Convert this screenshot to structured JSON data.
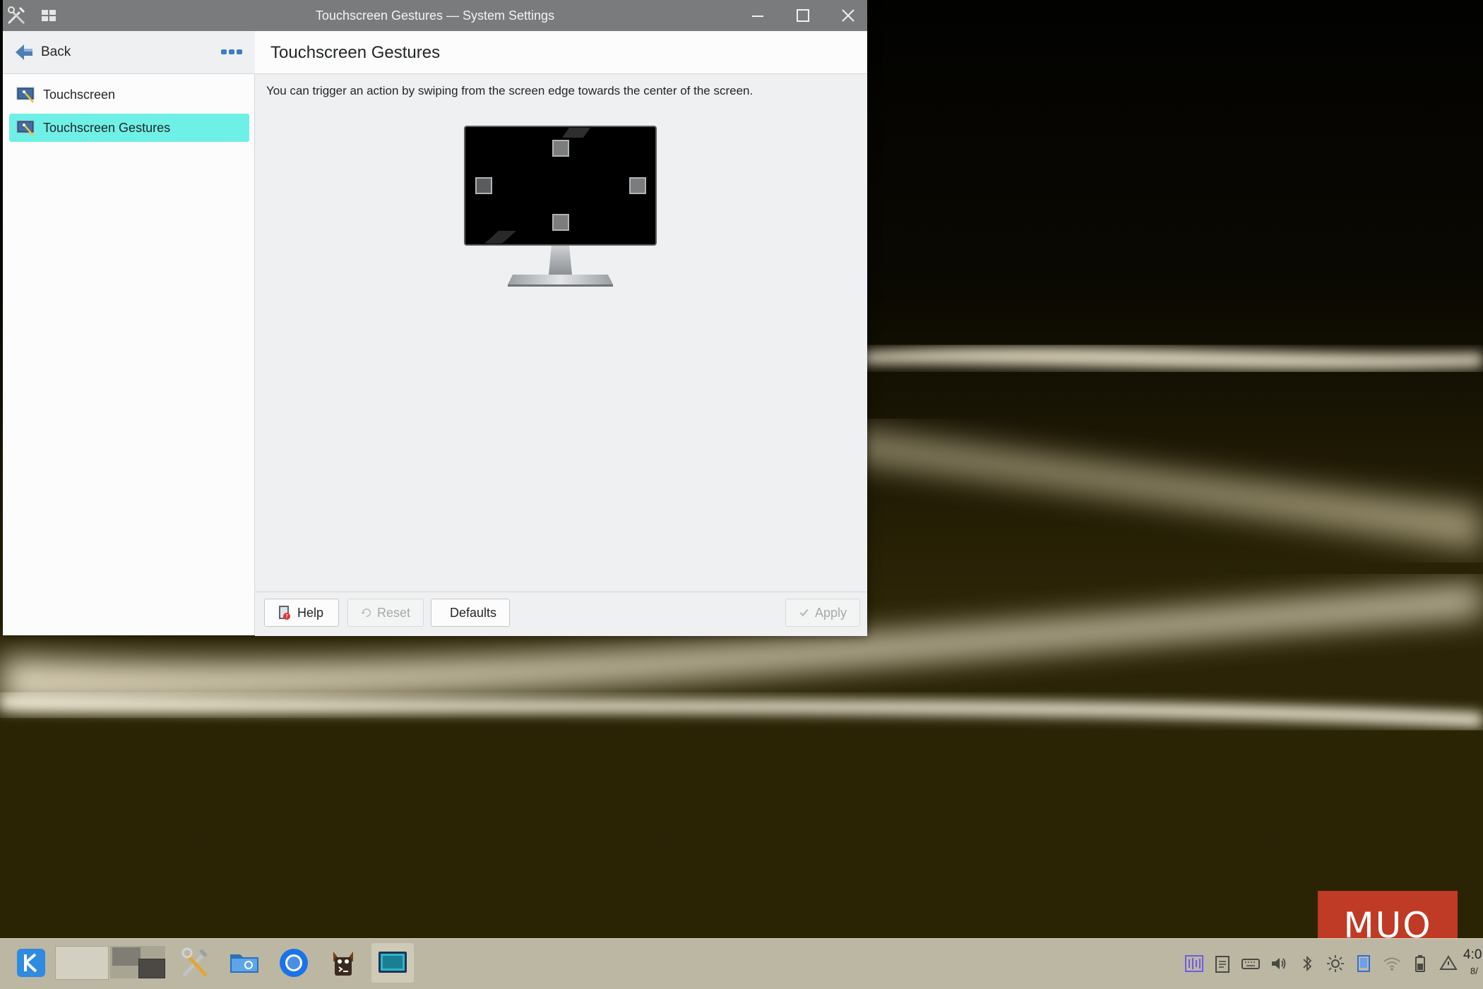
{
  "window": {
    "title": "Touchscreen Gestures — System Settings"
  },
  "sidebar": {
    "back_label": "Back",
    "items": [
      {
        "label": "Touchscreen",
        "icon": "touchscreen-icon"
      },
      {
        "label": "Touchscreen Gestures",
        "icon": "touchscreen-icon",
        "selected": true
      }
    ]
  },
  "main": {
    "title": "Touchscreen Gestures",
    "description": "You can trigger an action by swiping from the screen edge towards the center of the screen."
  },
  "footer": {
    "help": "Help",
    "reset": "Reset",
    "defaults": "Defaults",
    "apply": "Apply"
  },
  "taskbar": {
    "apps": [
      "kde-menu-icon",
      "virtual-desktop-1",
      "virtual-desktop-2",
      "system-settings-icon",
      "file-manager-icon",
      "chromium-icon",
      "terminal-icon",
      "screen-icon"
    ],
    "tray": [
      "activity-icon",
      "clipboard-icon",
      "keyboard-icon",
      "volume-icon",
      "bluetooth-icon",
      "brightness-icon",
      "display-icon",
      "wifi-icon",
      "battery-icon",
      "notifications-icon"
    ],
    "clock": "4:0",
    "date": "8/"
  },
  "watermark": {
    "text": "MUO"
  },
  "colors": {
    "selection": "#6ff0e6",
    "titlebar": "#7a7b7c",
    "taskbar": "#bcb7a3",
    "watermark": "#d9402c"
  }
}
